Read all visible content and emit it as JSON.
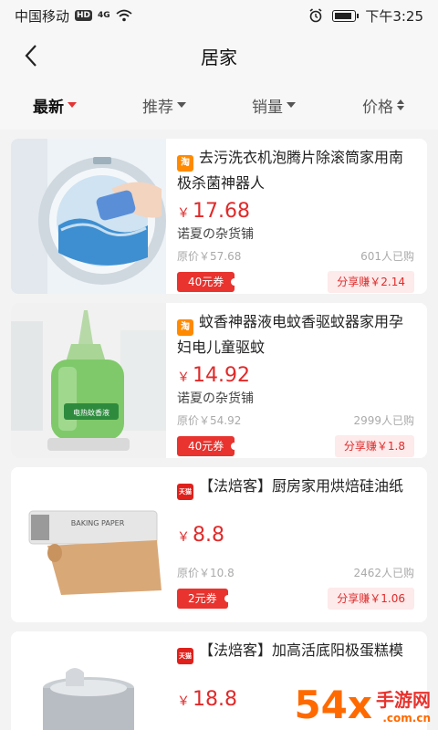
{
  "status_bar": {
    "carrier": "中国移动",
    "hd": "HD",
    "signal": "4G",
    "time": "下午3:25"
  },
  "nav": {
    "title": "居家"
  },
  "sort_tabs": [
    {
      "label": "最新",
      "active": true
    },
    {
      "label": "推荐"
    },
    {
      "label": "销量"
    },
    {
      "label": "价格"
    }
  ],
  "products": [
    {
      "source": "淘",
      "title": "去污洗衣机泡腾片除滚筒家用南极杀菌神器人",
      "price": "17.68",
      "shop": "诺夏の杂货铺",
      "original_price": "原价￥57.68",
      "sold": "601人已购",
      "coupon": "40元券",
      "share": "分享赚￥2.14"
    },
    {
      "source": "淘",
      "title": "蚊香神器液电蚊香驱蚊器家用孕妇电儿童驱蚊",
      "price": "14.92",
      "shop": "诺夏の杂货铺",
      "original_price": "原价￥54.92",
      "sold": "2999人已购",
      "coupon": "40元券",
      "share": "分享赚￥1.8",
      "label_text": "电热蚊香液"
    },
    {
      "source": "天猫",
      "title": "【法焙客】厨房家用烘焙硅油纸",
      "price": "8.8",
      "original_price": "原价￥10.8",
      "sold": "2462人已购",
      "coupon": "2元券",
      "share": "分享赚￥1.06",
      "label_text": "BAKING PAPER"
    },
    {
      "source": "天猫",
      "title": "【法焙客】加高活底阳极蛋糕模",
      "price": "18.8"
    }
  ],
  "currency": "￥",
  "watermark": {
    "num": "54ⅹ",
    "line1": "手游网",
    "line2": ".com.cn"
  }
}
